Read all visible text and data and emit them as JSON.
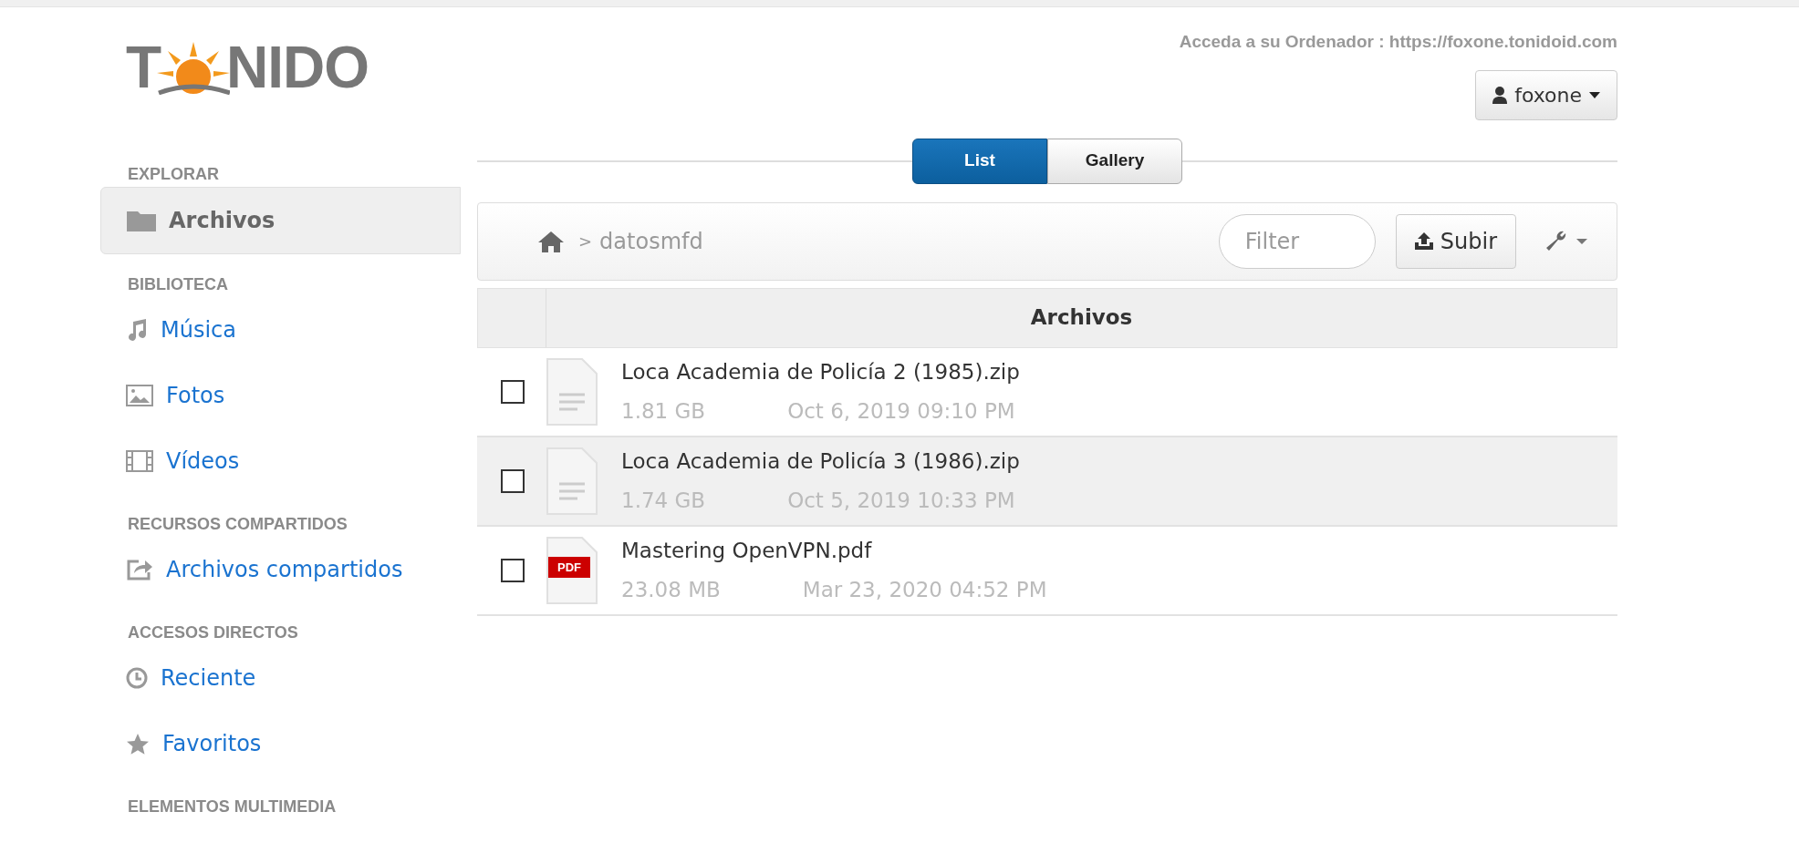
{
  "logo": {
    "left": "T",
    "right": "NIDO"
  },
  "access_text": "Acceda a su Ordenador : https://foxone.tonidoid.com",
  "user_menu": {
    "label": "foxone"
  },
  "sidebar": {
    "sections": [
      {
        "title": "EXPLORAR",
        "items": [
          {
            "label": "Archivos",
            "kind": "folder",
            "selected": true
          }
        ]
      },
      {
        "title": "BIBLIOTECA",
        "items": [
          {
            "label": "Música",
            "kind": "music",
            "selected": false
          },
          {
            "label": "Fotos",
            "kind": "image",
            "selected": false
          },
          {
            "label": "Vídeos",
            "kind": "film",
            "selected": false
          }
        ]
      },
      {
        "title": "RECURSOS COMPARTIDOS",
        "items": [
          {
            "label": "Archivos compartidos",
            "kind": "share",
            "selected": false
          }
        ]
      },
      {
        "title": "ACCESOS DIRECTOS",
        "items": [
          {
            "label": "Reciente",
            "kind": "clock",
            "selected": false
          },
          {
            "label": "Favoritos",
            "kind": "star",
            "selected": false
          }
        ]
      },
      {
        "title": "ELEMENTOS MULTIMEDIA"
      }
    ]
  },
  "view_tabs": [
    {
      "label": "List",
      "selected": true
    },
    {
      "label": "Gallery",
      "selected": false
    }
  ],
  "breadcrumb": {
    "separator": ">",
    "path": "datosmfd"
  },
  "filter": {
    "placeholder": "Filter"
  },
  "upload_button": "Subir",
  "table": {
    "column": "Archivos",
    "rows": [
      {
        "name": "Loca Academia de Policía 2 (1985).zip",
        "size": "1.81 GB",
        "date": "Oct 6, 2019 09:10 PM",
        "kind": "document",
        "checked": false,
        "highlighted": false
      },
      {
        "name": "Loca Academia de Policía 3 (1986).zip",
        "size": "1.74 GB",
        "date": "Oct 5, 2019 10:33 PM",
        "kind": "document",
        "checked": false,
        "highlighted": true
      },
      {
        "name": "Mastering OpenVPN.pdf",
        "size": "23.08 MB",
        "date": "Mar 23, 2020 04:52 PM",
        "kind": "pdf",
        "badge": "PDF",
        "checked": false,
        "highlighted": false
      }
    ]
  }
}
